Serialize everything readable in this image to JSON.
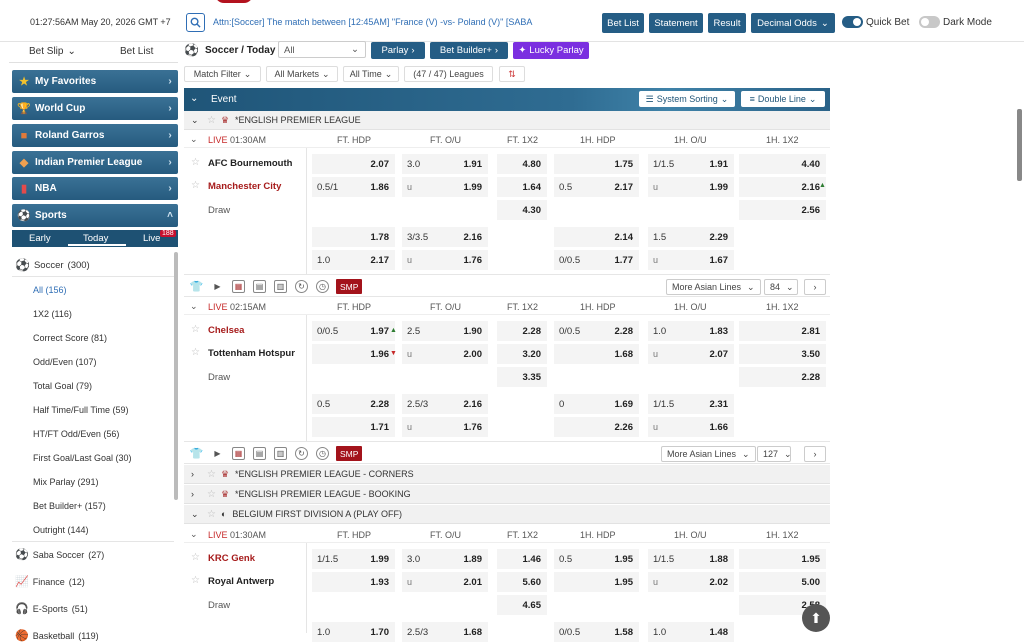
{
  "header": {
    "clock": "01:27:56AM May 20, 2026 GMT +7",
    "ticker": "Attn:[Soccer] The match between [12:45AM] \"France (V) -vs- Poland (V)\" [SABA",
    "buttons": {
      "bet_list": "Bet List",
      "statement": "Statement",
      "result": "Result",
      "odds": "Decimal Odds"
    },
    "quick_bet": "Quick Bet",
    "dark_mode": "Dark Mode"
  },
  "sidebar": {
    "tabs": {
      "bet_slip": "Bet Slip",
      "bet_list": "Bet List"
    },
    "categories": [
      {
        "label": "My Favorites"
      },
      {
        "label": "World Cup"
      },
      {
        "label": "Roland Garros"
      },
      {
        "label": "Indian Premier League"
      },
      {
        "label": "NBA"
      },
      {
        "label": "Sports"
      }
    ],
    "subtabs": {
      "early": "Early",
      "today": "Today",
      "live": "Live",
      "live_count": "188"
    },
    "soccer": {
      "label": "Soccer",
      "count": "(300)"
    },
    "sub_items": [
      {
        "label": "All",
        "count": "(156)"
      },
      {
        "label": "1X2",
        "count": "(116)"
      },
      {
        "label": "Correct Score",
        "count": "(81)"
      },
      {
        "label": "Odd/Even",
        "count": "(107)"
      },
      {
        "label": "Total Goal",
        "count": "(79)"
      },
      {
        "label": "Half Time/Full Time",
        "count": "(59)"
      },
      {
        "label": "HT/FT Odd/Even",
        "count": "(56)"
      },
      {
        "label": "First Goal/Last Goal",
        "count": "(30)"
      },
      {
        "label": "Mix Parlay",
        "count": "(291)"
      },
      {
        "label": "Bet Builder+",
        "count": "(157)"
      },
      {
        "label": "Outright",
        "count": "(144)"
      }
    ],
    "other_sports": [
      {
        "label": "Saba Soccer",
        "count": "(27)"
      },
      {
        "label": "Finance",
        "count": "(12)"
      },
      {
        "label": "E-Sports",
        "count": "(51)"
      },
      {
        "label": "Basketball",
        "count": "(119)"
      }
    ]
  },
  "main": {
    "title": "Soccer / Today",
    "market_select": "All",
    "pills": {
      "parlay": "Parlay",
      "bet_builder": "Bet Builder+",
      "lucky": "Lucky Parlay"
    },
    "filters": {
      "match": "Match Filter",
      "markets": "All Markets",
      "time": "All Time",
      "leagues": "(47 / 47) Leagues"
    },
    "event_header": {
      "event": "Event",
      "sorting": "System Sorting",
      "line": "Double Line"
    },
    "columns": [
      "FT. HDP",
      "FT. O/U",
      "FT. 1X2",
      "1H. HDP",
      "1H. O/U",
      "1H. 1X2"
    ],
    "leagues": {
      "epl": "*ENGLISH PREMIER LEAGUE",
      "corners": "*ENGLISH PREMIER LEAGUE - CORNERS",
      "booking": "*ENGLISH PREMIER LEAGUE - BOOKING",
      "belgium": "BELGIUM FIRST DIVISION A (PLAY OFF)"
    },
    "live": "LIVE",
    "draw": "Draw",
    "smp": "SMP",
    "more_lines": "More Asian Lines",
    "matches": [
      {
        "time": "01:30AM",
        "home": "AFC Bournemouth",
        "away": "Manchester City",
        "more": "84",
        "r1": {
          "fthdp_h": "",
          "fthdp_v": "2.07",
          "ftou_h": "3.0",
          "ftou_v": "1.91",
          "ft1x2": "4.80",
          "hhdp_h": "",
          "hhdp_v": "1.75",
          "hou_h": "1/1.5",
          "hou_v": "1.91",
          "h1x2": "4.40"
        },
        "r2": {
          "fthdp_h": "0.5/1",
          "fthdp_v": "1.86",
          "ftou_h": "u",
          "ftou_v": "1.99",
          "ft1x2": "1.64",
          "hhdp_h": "0.5",
          "hhdp_v": "2.17",
          "hou_h": "u",
          "hou_v": "1.99",
          "h1x2": "2.16"
        },
        "r3": {
          "ft1x2": "4.30",
          "h1x2": "2.56"
        },
        "r4": {
          "fthdp_h": "",
          "fthdp_v": "1.78",
          "ftou_h": "3/3.5",
          "ftou_v": "2.16",
          "hhdp_h": "",
          "hhdp_v": "2.14",
          "hou_h": "1.5",
          "hou_v": "2.29"
        },
        "r5": {
          "fthdp_h": "1.0",
          "fthdp_v": "2.17",
          "ftou_h": "u",
          "ftou_v": "1.76",
          "hhdp_h": "0/0.5",
          "hhdp_v": "1.77",
          "hou_h": "u",
          "hou_v": "1.67"
        }
      },
      {
        "time": "02:15AM",
        "home": "Chelsea",
        "away": "Tottenham Hotspur",
        "more": "127",
        "r1": {
          "fthdp_h": "0/0.5",
          "fthdp_v": "1.97",
          "ftou_h": "2.5",
          "ftou_v": "1.90",
          "ft1x2": "2.28",
          "hhdp_h": "0/0.5",
          "hhdp_v": "2.28",
          "hou_h": "1.0",
          "hou_v": "1.83",
          "h1x2": "2.81"
        },
        "r2": {
          "fthdp_h": "",
          "fthdp_v": "1.96",
          "ftou_h": "u",
          "ftou_v": "2.00",
          "ft1x2": "3.20",
          "hhdp_h": "",
          "hhdp_v": "1.68",
          "hou_h": "u",
          "hou_v": "2.07",
          "h1x2": "3.50"
        },
        "r3": {
          "ft1x2": "3.35",
          "h1x2": "2.28"
        },
        "r4": {
          "fthdp_h": "0.5",
          "fthdp_v": "2.28",
          "ftou_h": "2.5/3",
          "ftou_v": "2.16",
          "hhdp_h": "0",
          "hhdp_v": "1.69",
          "hou_h": "1/1.5",
          "hou_v": "2.31"
        },
        "r5": {
          "fthdp_h": "",
          "fthdp_v": "1.71",
          "ftou_h": "u",
          "ftou_v": "1.76",
          "hhdp_h": "",
          "hhdp_v": "2.26",
          "hou_h": "u",
          "hou_v": "1.66"
        }
      },
      {
        "time": "01:30AM",
        "home": "KRC Genk",
        "away": "Royal Antwerp",
        "r1": {
          "fthdp_h": "1/1.5",
          "fthdp_v": "1.99",
          "ftou_h": "3.0",
          "ftou_v": "1.89",
          "ft1x2": "1.46",
          "hhdp_h": "0.5",
          "hhdp_v": "1.95",
          "hou_h": "1/1.5",
          "hou_v": "1.88",
          "h1x2": "1.95"
        },
        "r2": {
          "fthdp_h": "",
          "fthdp_v": "1.93",
          "ftou_h": "u",
          "ftou_v": "2.01",
          "ft1x2": "5.60",
          "hhdp_h": "",
          "hhdp_v": "1.95",
          "hou_h": "u",
          "hou_v": "2.02",
          "h1x2": "5.00"
        },
        "r3": {
          "ft1x2": "4.65",
          "h1x2": "2.58"
        },
        "r4": {
          "fthdp_h": "1.0",
          "fthdp_v": "1.70",
          "ftou_h": "2.5/3",
          "ftou_v": "1.68",
          "hhdp_h": "0/0.5",
          "hhdp_v": "1.58",
          "hou_h": "1.0",
          "hou_v": "1.48"
        }
      }
    ]
  },
  "colors": {
    "nav": "#265b7f",
    "accent": "#2f6eb5",
    "red": "#a61b1b",
    "smp": "#a3131b",
    "lucky": "#7b2fe0"
  }
}
